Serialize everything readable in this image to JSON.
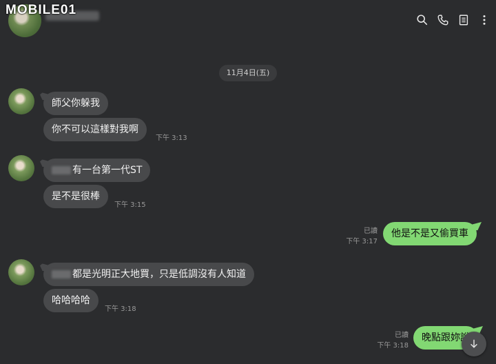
{
  "watermark": "MOBILE01",
  "header": {
    "icons": [
      "search-icon",
      "phone-icon",
      "notes-icon",
      "more-icon"
    ]
  },
  "date_divider": "11月4日(五)",
  "messages": [
    {
      "side": "in",
      "text": "師父你躲我"
    },
    {
      "side": "in",
      "text": "你不可以這樣對我啊",
      "time": "下午 3:13"
    },
    {
      "side": "in",
      "text": "有一台第一代ST"
    },
    {
      "side": "in",
      "text": "是不是很棒",
      "time": "下午 3:15"
    },
    {
      "side": "out",
      "text": "他是不是又偷買車",
      "read": "已讀",
      "time": "下午 3:17"
    },
    {
      "side": "in",
      "text": "都是光明正大地買，只是低調沒有人知道"
    },
    {
      "side": "in",
      "text": "哈哈哈哈",
      "time": "下午 3:18"
    },
    {
      "side": "out",
      "text": "晚點跟妳說",
      "read": "已讀",
      "time": "下午 3:18"
    }
  ],
  "colors": {
    "background": "#2b2c2e",
    "incoming_bubble": "#48494b",
    "outgoing_bubble": "#82d873"
  },
  "scroll_button_icon": "arrow-down-icon"
}
